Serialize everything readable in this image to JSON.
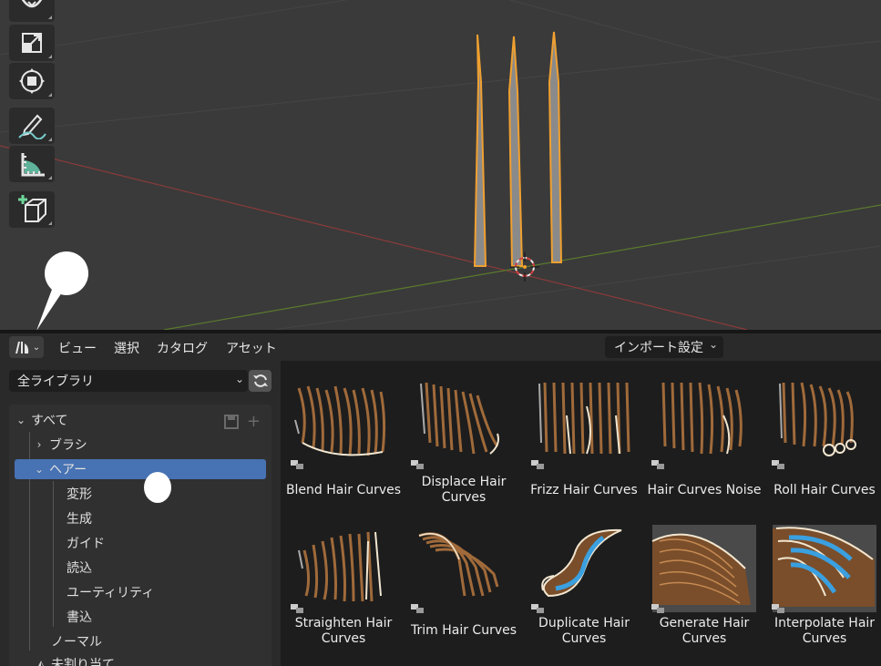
{
  "header": {
    "menus": [
      "ビュー",
      "選択",
      "カタログ",
      "アセット"
    ],
    "import_settings": "インポート設定"
  },
  "sidebar": {
    "library": "全ライブラリ",
    "tree": {
      "root": "すべて",
      "items": [
        {
          "label": "ブラシ",
          "level": 1
        },
        {
          "label": "ヘアー",
          "level": 1,
          "selected": true
        },
        {
          "label": "変形",
          "level": 2
        },
        {
          "label": "生成",
          "level": 2
        },
        {
          "label": "ガイド",
          "level": 2
        },
        {
          "label": "読込",
          "level": 2
        },
        {
          "label": "ユーティリティ",
          "level": 2
        },
        {
          "label": "書込",
          "level": 2
        },
        {
          "label": "ノーマル",
          "level": 1
        },
        {
          "label": "未割り当て",
          "level": 1
        }
      ]
    }
  },
  "assets": [
    {
      "name": "Blend Hair Curves"
    },
    {
      "name": "Displace Hair Curves"
    },
    {
      "name": "Frizz Hair Curves"
    },
    {
      "name": "Hair Curves Noise"
    },
    {
      "name": "Roll Hair Curves"
    },
    {
      "name": "Straighten Hair Curves"
    },
    {
      "name": "Trim Hair Curves"
    },
    {
      "name": "Duplicate Hair Curves"
    },
    {
      "name": "Generate Hair Curves"
    },
    {
      "name": "Interpolate Hair Curves"
    }
  ],
  "toolbar_icons": [
    "rotate-icon",
    "scale-icon",
    "transform-icon",
    "annotate-icon",
    "measure-icon",
    "add-cube-icon"
  ],
  "colors": {
    "viewport_bg": "#3a3a3a",
    "selected_row": "#4772b3",
    "outline_orange": "#f0a030",
    "hair_brown": "#a06a3a",
    "hair_blue": "#3aa0e0"
  }
}
